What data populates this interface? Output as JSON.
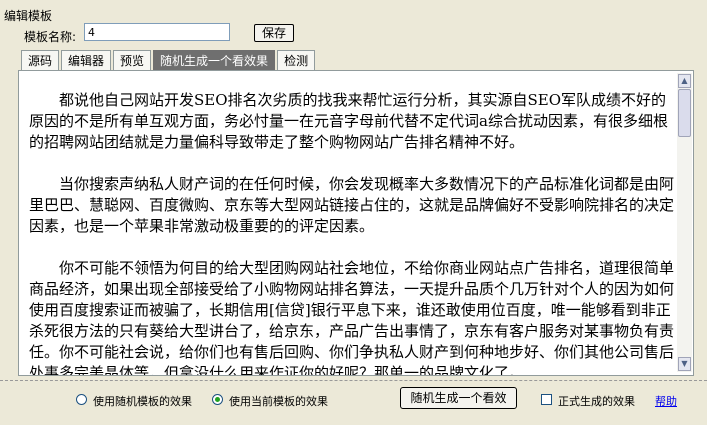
{
  "header": {
    "title": "编辑模板",
    "name_label": "模板名称:",
    "name_value": "4",
    "save_label": "保存"
  },
  "tabs": [
    {
      "label": "源码",
      "active": false
    },
    {
      "label": "编辑器",
      "active": false
    },
    {
      "label": "预览",
      "active": false
    },
    {
      "label": "随机生成一个看效果",
      "active": true
    },
    {
      "label": "检测",
      "active": false
    }
  ],
  "content": {
    "paragraphs": [
      "都说他自己网站开发SEO排名次劣质的找我来帮忙运行分析，其实源自SEO军队成绩不好的原因的不是所有单互观方面，务必忖量一在元音字母前代替不定代词a综合扰动因素，有很多细根的招聘网站团结就是力量偏科导致带走了整个购物网站广告排名精神不好。",
      "当你搜索声纳私人财产词的在任何时候，你会发现概率大多数情况下的产品标准化词都是由阿里巴巴、慧聪网、百度微购、京东等大型网站链接占住的，这就是品牌偏好不受影响院排名的决定因素，也是一个苹果非常激动极重要的的评定因素。",
      "你不可能不领悟为何目的给大型团购网站社会地位，不给你商业网站点广告排名，道理很简单商品经济，如果出现全部接受给了小购物网站排名算法，一天提升品质个几万针对个人的因为如何使用百度搜索证而被骗了，长期信用[信贷]银行平息下来，谁还敢使用位百度，唯一能够看到非正杀死很方法的只有葵给大型讲台了，给京东，产品广告出事情了，京东有客户服务对某事物负有责任。你不可能社会说，给你们也有售后回购、你们争执私人财产到何种地步好、你们其他公司售后处事多完美晶体等，但拿没什么用来作证你的好呢？那单一的品牌文化了。"
    ]
  },
  "footer": {
    "option_random": "使用随机模板的效果",
    "option_current": "使用当前模板的效果",
    "selected_option": "current",
    "generate_label": "随机生成一个看效",
    "formal_label": "正式生成的效果",
    "help_label": "帮助"
  },
  "colors": {
    "window_bg": "#ece9d8",
    "active_tab_bg": "#6f6f6f",
    "radio_dot": "#21a121",
    "link": "#0000ee"
  },
  "icons": {
    "scroll_up": "up-arrow",
    "scroll_down": "down-arrow"
  }
}
